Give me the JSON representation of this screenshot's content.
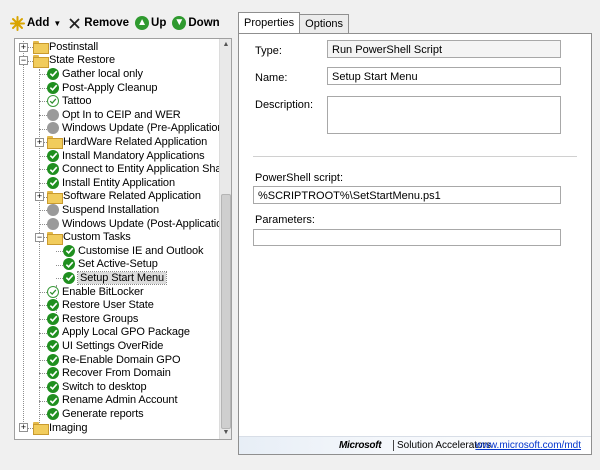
{
  "toolbar": {
    "add_label": "Add",
    "remove_label": "Remove",
    "up_label": "Up",
    "down_label": "Down"
  },
  "tree": {
    "items": [
      {
        "label": "Postinstall",
        "kind": "folder",
        "depth": 1,
        "expander": "+"
      },
      {
        "label": "State Restore",
        "kind": "folder",
        "depth": 1,
        "expander": "-"
      },
      {
        "label": "Gather local only",
        "kind": "check",
        "depth": 2
      },
      {
        "label": "Post-Apply Cleanup",
        "kind": "check",
        "depth": 2
      },
      {
        "label": "Tattoo",
        "kind": "hollow",
        "depth": 2
      },
      {
        "label": "Opt In to CEIP and WER",
        "kind": "gray",
        "depth": 2
      },
      {
        "label": "Windows Update (Pre-Application Inst",
        "kind": "gray",
        "depth": 2
      },
      {
        "label": "HardWare Related Application",
        "kind": "folder",
        "depth": 2,
        "expander": "+"
      },
      {
        "label": "Install Mandatory Applications",
        "kind": "check",
        "depth": 2
      },
      {
        "label": "Connect to Entity Application Share",
        "kind": "check",
        "depth": 2
      },
      {
        "label": "Install Entity Application",
        "kind": "check",
        "depth": 2
      },
      {
        "label": "Software Related Application",
        "kind": "folder",
        "depth": 2,
        "expander": "+"
      },
      {
        "label": "Suspend Installation",
        "kind": "gray",
        "depth": 2
      },
      {
        "label": "Windows Update (Post-Application Ins",
        "kind": "gray",
        "depth": 2
      },
      {
        "label": "Custom Tasks",
        "kind": "folder",
        "depth": 2,
        "expander": "-"
      },
      {
        "label": "Customise IE and Outlook",
        "kind": "check",
        "depth": 3
      },
      {
        "label": "Set Active-Setup",
        "kind": "check",
        "depth": 3
      },
      {
        "label": "Setup Start Menu",
        "kind": "check",
        "depth": 3,
        "selected": true
      },
      {
        "label": "Enable BitLocker",
        "kind": "hollow",
        "depth": 2
      },
      {
        "label": "Restore User State",
        "kind": "check",
        "depth": 2
      },
      {
        "label": "Restore Groups",
        "kind": "check",
        "depth": 2
      },
      {
        "label": "Apply Local GPO Package",
        "kind": "check",
        "depth": 2
      },
      {
        "label": "UI Settings OverRide",
        "kind": "check",
        "depth": 2
      },
      {
        "label": "Re-Enable Domain GPO",
        "kind": "check",
        "depth": 2
      },
      {
        "label": "Recover From Domain",
        "kind": "check",
        "depth": 2
      },
      {
        "label": "Switch to desktop",
        "kind": "check",
        "depth": 2
      },
      {
        "label": "Rename Admin Account",
        "kind": "check",
        "depth": 2
      },
      {
        "label": "Generate reports",
        "kind": "check",
        "depth": 2
      },
      {
        "label": "Imaging",
        "kind": "folder",
        "depth": 1,
        "expander": "+"
      }
    ]
  },
  "tabs": {
    "properties": "Properties",
    "options": "Options"
  },
  "form": {
    "type_label": "Type:",
    "type_value": "Run PowerShell Script",
    "name_label": "Name:",
    "name_value": "Setup Start Menu",
    "description_label": "Description:",
    "description_value": "",
    "script_label": "PowerShell script:",
    "script_value": "%SCRIPTROOT%\\SetStartMenu.ps1",
    "parameters_label": "Parameters:",
    "parameters_value": ""
  },
  "footer": {
    "brand": "Microsoft",
    "product": "Solution Accelerators",
    "link": "www.microsoft.com/mdt"
  },
  "colors": {
    "success_green": "#1f8f1f",
    "folder_yellow": "#f1cc5c",
    "link_blue": "#0033cc"
  }
}
